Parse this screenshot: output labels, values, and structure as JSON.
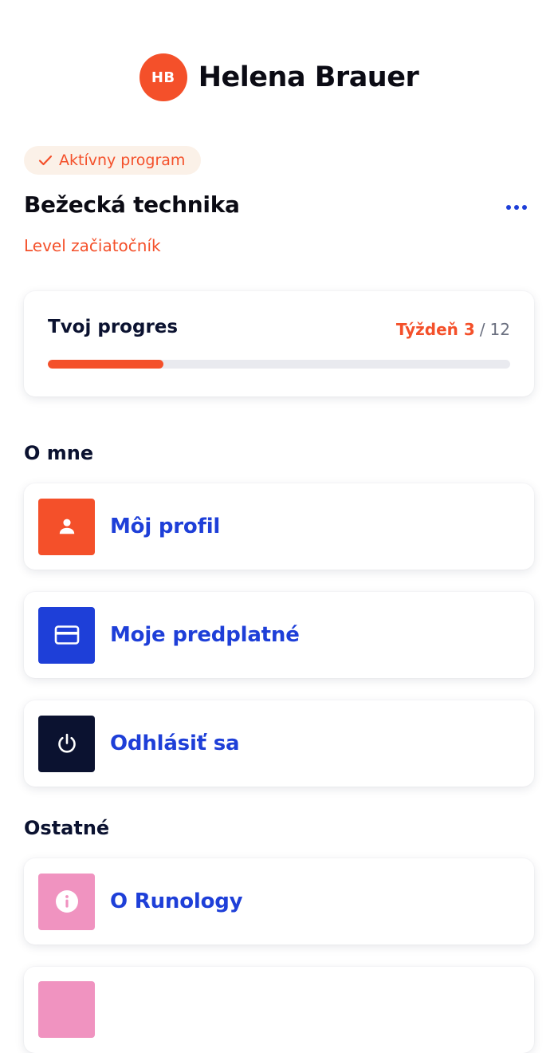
{
  "header": {
    "avatar_initials": "HB",
    "user_name": "Helena Brauer"
  },
  "program": {
    "badge_label": "Aktívny program",
    "title": "Bežecká technika",
    "level": "Level začiatočník"
  },
  "progress": {
    "label": "Tvoj progres",
    "week_current": "Týždeň 3",
    "week_separator": "/",
    "week_total": "12",
    "fraction": 0.25
  },
  "sections": {
    "about_me": "O mne",
    "other": "Ostatné"
  },
  "menu": {
    "profile": {
      "label": "Môj profil",
      "icon": "person-icon",
      "color": "#f4502a"
    },
    "subscription": {
      "label": "Moje predplatné",
      "icon": "credit-card-icon",
      "color": "#1e3fd8"
    },
    "logout": {
      "label": "Odhlásiť sa",
      "icon": "power-icon",
      "color": "#0b1230"
    },
    "about_runology": {
      "label": "O Runology",
      "icon": "info-icon",
      "color": "#f093c0"
    },
    "next_item": {
      "icon": "pink-tile-icon",
      "color": "#f093c0"
    }
  },
  "colors": {
    "accent_orange": "#f4502a",
    "accent_blue": "#1e3fd8",
    "badge_bg": "#fbf1e8",
    "text_dark": "#0b1230"
  }
}
